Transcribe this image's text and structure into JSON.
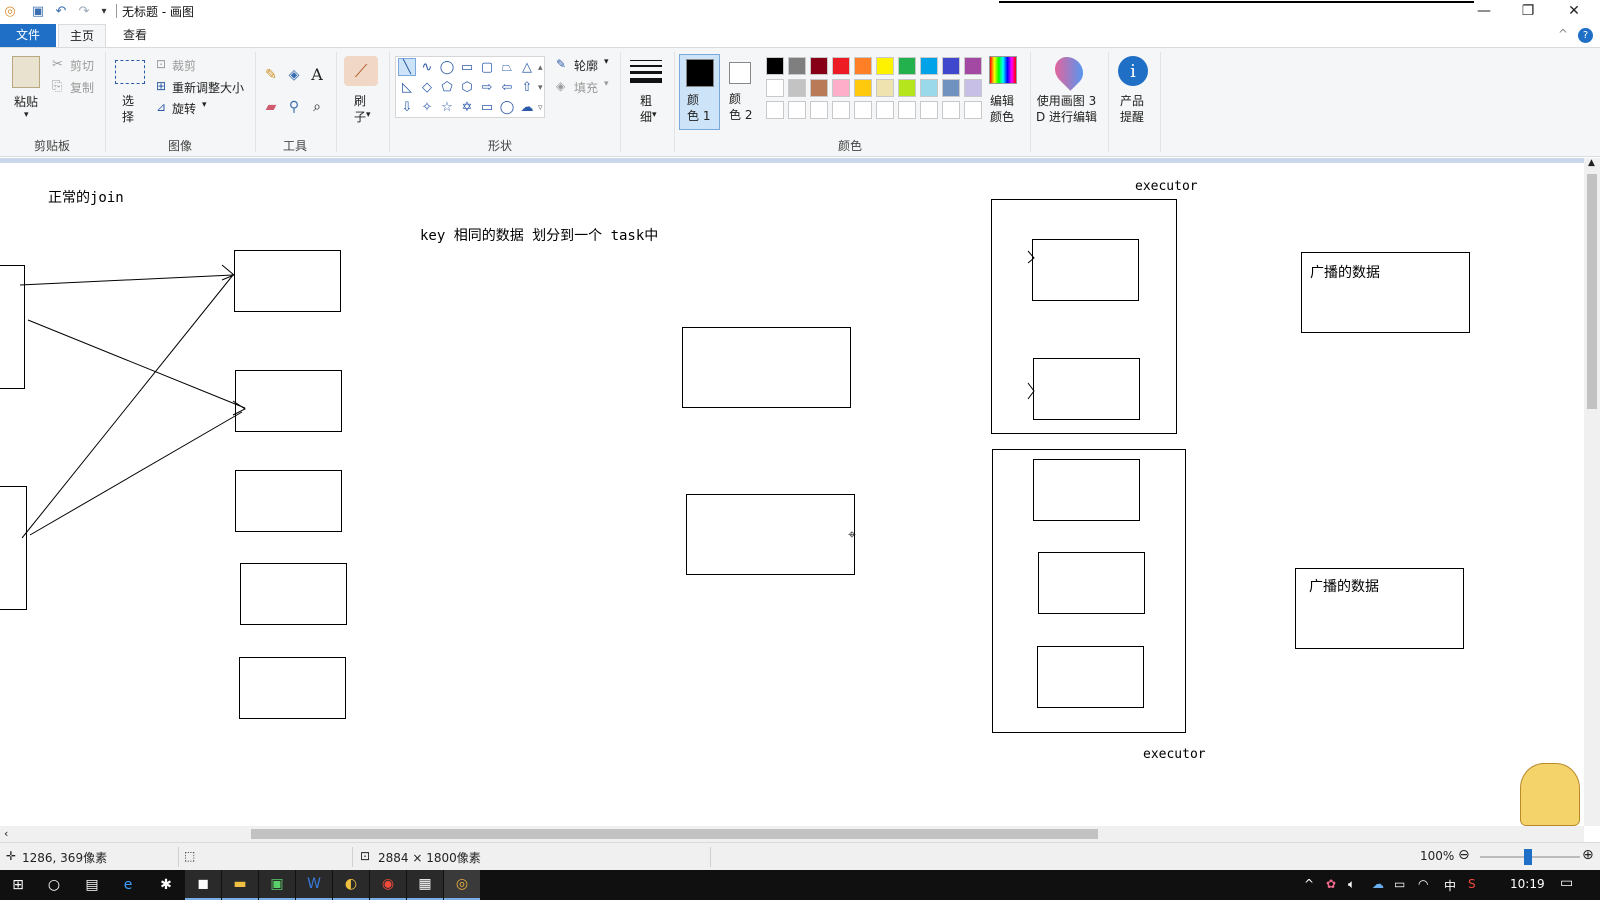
{
  "window": {
    "title": "无标题 - 画图",
    "controls": {
      "minimize": "—",
      "restore": "❐",
      "close": "✕"
    }
  },
  "quick_access": {
    "icons": [
      "paint-app-icon",
      "save-icon",
      "undo-icon",
      "redo-icon",
      "customize-qat-icon"
    ]
  },
  "tabs": [
    {
      "label": "文件",
      "active": false
    },
    {
      "label": "主页",
      "active": true
    },
    {
      "label": "查看",
      "active": false
    }
  ],
  "ribbon_help": {
    "collapse": "^",
    "help": "?"
  },
  "ribbon": {
    "clipboard": {
      "group": "剪贴板",
      "paste": "粘贴",
      "cut": "剪切",
      "copy": "复制"
    },
    "image": {
      "group": "图像",
      "select": "选\n择",
      "crop": "裁剪",
      "resize": "重新调整大小",
      "rotate": "旋转"
    },
    "tools": {
      "group": "工具"
    },
    "brushes": {
      "label": "刷\n子"
    },
    "shapes": {
      "group": "形状",
      "outline": "轮廓",
      "fill": "填充"
    },
    "size": {
      "label": "粗\n细"
    },
    "colors": {
      "group": "颜色",
      "color1": "颜\n色 1",
      "color2": "颜\n色 2",
      "edit": "编辑\n颜色",
      "row1": [
        "#000000",
        "#7f7f7f",
        "#880015",
        "#ed1c24",
        "#ff7f27",
        "#fff200",
        "#22b14c",
        "#00a2e8",
        "#3f48cc",
        "#a349a4"
      ],
      "row2": [
        "#ffffff",
        "#c3c3c3",
        "#b97a57",
        "#ffaec9",
        "#ffc90e",
        "#efe4b0",
        "#b5e61d",
        "#99d9ea",
        "#7092be",
        "#c8bfe7"
      ],
      "row3": [
        "#ffffff",
        "#ffffff",
        "#ffffff",
        "#ffffff",
        "#ffffff",
        "#ffffff",
        "#ffffff",
        "#ffffff",
        "#ffffff",
        "#ffffff"
      ]
    },
    "paint3d": {
      "label": "使用画图 3\nD 进行编辑"
    },
    "product": {
      "label": "产品\n提醒"
    }
  },
  "canvas": {
    "texts": {
      "normal_join": "正常的join",
      "key_note": "key 相同的数据 划分到一个 task中",
      "executor_top": "executor",
      "executor_bottom": "executor",
      "broadcast_1": "广播的数据",
      "broadcast_2": "广播的数据"
    }
  },
  "status": {
    "cursor": "1286, 369像素",
    "size": "2884 × 1800像素",
    "zoom": "100%"
  },
  "taskbar": {
    "time": "10:19",
    "ime": "中",
    "apps": [
      "start-icon",
      "search-icon",
      "store-icon",
      "edge-icon",
      "pin-icon",
      "intellij-icon",
      "explorer-icon",
      "pycharm-icon",
      "word-icon",
      "tool-icon",
      "chrome-icon",
      "calculator-icon",
      "paint-icon"
    ]
  }
}
